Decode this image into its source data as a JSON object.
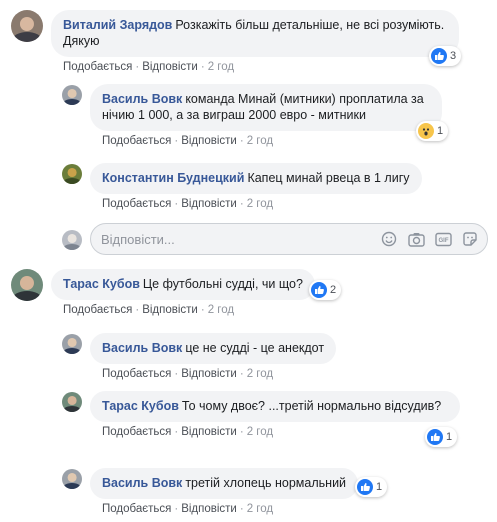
{
  "comments": [
    {
      "author": "Виталий Зарядов",
      "text": "Розкажіть більш детальніше, не всі розуміють. Дякую",
      "like": "Подобається",
      "reply": "Відповісти",
      "time": "2 год",
      "reaction_count": "3",
      "reaction_type": "like"
    },
    {
      "author": "Василь Вовк",
      "text": "команда Минай (митники) проплатила за нічию 1 000, а за виграш 2000 евро - митники",
      "like": "Подобається",
      "reply": "Відповісти",
      "time": "2 год",
      "reaction_count": "1",
      "reaction_type": "wow"
    },
    {
      "author": "Константин Буднецкий",
      "text": "Капец минай рвеца в 1 лигу",
      "like": "Подобається",
      "reply": "Відповісти",
      "time": "2 год"
    },
    {
      "author": "Тарас Кубов",
      "text": "Це футбольні судді, чи що?",
      "like": "Подобається",
      "reply": "Відповісти",
      "time": "2 год",
      "reaction_count": "2",
      "reaction_type": "like"
    },
    {
      "author": "Василь Вовк",
      "text": "це не судді - це анекдот",
      "like": "Подобається",
      "reply": "Відповісти",
      "time": "2 год"
    },
    {
      "author": "Тарас Кубов",
      "text": "То чому двоє? ...третій нормально відсудив?",
      "like": "Подобається",
      "reply": "Відповісти",
      "time": "2 год",
      "reaction_count": "1",
      "reaction_type": "like"
    },
    {
      "author": "Василь Вовк",
      "text": "третій хлопець нормальний",
      "like": "Подобається",
      "reply": "Відповісти",
      "time": "2 год",
      "reaction_count": "1",
      "reaction_type": "like"
    }
  ],
  "reply_box": {
    "placeholder": "Відповісти...",
    "icons": [
      "emoji-icon",
      "camera-icon",
      "gif-icon",
      "sticker-icon"
    ]
  },
  "colors": {
    "author": "#385898",
    "bubble": "#f2f3f5",
    "like_blue": "#2078f4",
    "meta_gray": "#90949c"
  }
}
